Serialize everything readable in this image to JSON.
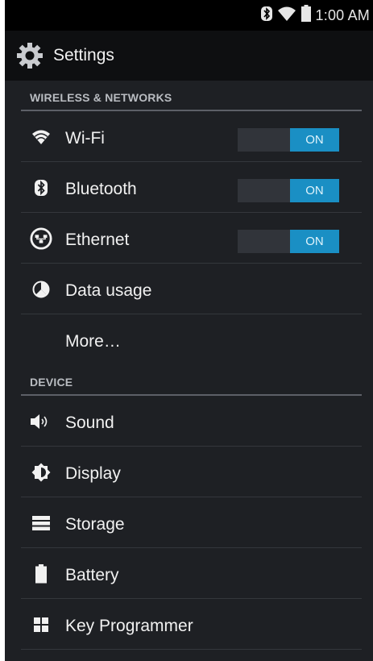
{
  "status_bar": {
    "time": "1:00 AM",
    "icons": [
      "bluetooth-icon",
      "wifi-signal-icon",
      "battery-icon"
    ]
  },
  "action_bar": {
    "title": "Settings",
    "icon": "settings-gear-icon"
  },
  "sections": [
    {
      "label": "WIRELESS & NETWORKS",
      "items": [
        {
          "label": "Wi-Fi",
          "icon": "wifi-icon",
          "toggle": "ON"
        },
        {
          "label": "Bluetooth",
          "icon": "bluetooth-icon",
          "toggle": "ON"
        },
        {
          "label": "Ethernet",
          "icon": "ethernet-icon",
          "toggle": "ON"
        },
        {
          "label": "Data usage",
          "icon": "data-usage-icon"
        },
        {
          "label": "More…"
        }
      ]
    },
    {
      "label": "DEVICE",
      "items": [
        {
          "label": "Sound",
          "icon": "sound-icon"
        },
        {
          "label": "Display",
          "icon": "display-icon"
        },
        {
          "label": "Storage",
          "icon": "storage-icon"
        },
        {
          "label": "Battery",
          "icon": "battery-icon"
        },
        {
          "label": "Key Programmer",
          "icon": "key-programmer-icon"
        }
      ]
    }
  ],
  "colors": {
    "background": "#1e2024",
    "accent": "#1a8fc4",
    "status_bar": "#000000",
    "action_bar": "#0e0f11"
  }
}
